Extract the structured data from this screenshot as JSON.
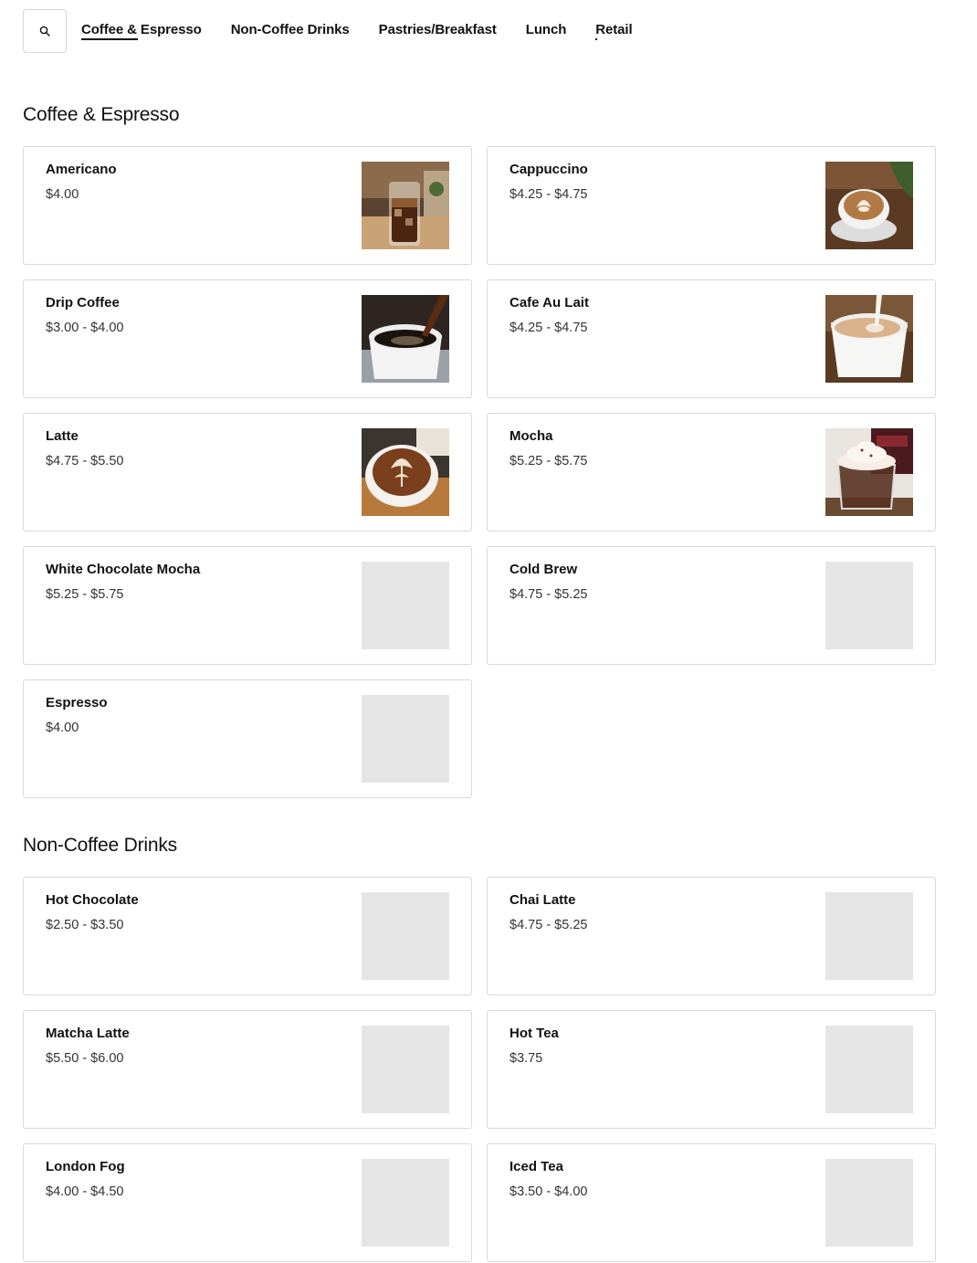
{
  "nav": {
    "search_icon": "search-icon",
    "tabs": [
      {
        "label": "Coffee & Espresso",
        "active": true
      },
      {
        "label": "Non-Coffee Drinks",
        "active": false
      },
      {
        "label": "Pastries/Breakfast",
        "active": false
      },
      {
        "label": "Lunch",
        "active": false
      },
      {
        "label": "Retail",
        "active": false
      }
    ]
  },
  "sections": [
    {
      "title": "Coffee & Espresso",
      "items": [
        {
          "name": "Americano",
          "price": "$4.00",
          "image": "iced-americano-photo"
        },
        {
          "name": "Cappuccino",
          "price": "$4.25 - $4.75",
          "image": "cappuccino-photo"
        },
        {
          "name": "Drip Coffee",
          "price": "$3.00 - $4.00",
          "image": "drip-coffee-photo"
        },
        {
          "name": "Cafe Au Lait",
          "price": "$4.25 - $4.75",
          "image": "cafe-au-lait-photo"
        },
        {
          "name": "Latte",
          "price": "$4.75 - $5.50",
          "image": "latte-photo"
        },
        {
          "name": "Mocha",
          "price": "$5.25 - $5.75",
          "image": "mocha-photo"
        },
        {
          "name": "White Chocolate Mocha",
          "price": "$5.25 - $5.75",
          "image": null
        },
        {
          "name": "Cold Brew",
          "price": "$4.75 - $5.25",
          "image": null
        },
        {
          "name": "Espresso",
          "price": "$4.00",
          "image": null
        }
      ]
    },
    {
      "title": "Non-Coffee Drinks",
      "items": [
        {
          "name": "Hot Chocolate",
          "price": "$2.50 - $3.50",
          "image": null
        },
        {
          "name": "Chai Latte",
          "price": "$4.75 - $5.25",
          "image": null
        },
        {
          "name": "Matcha Latte",
          "price": "$5.50 - $6.00",
          "image": null
        },
        {
          "name": "Hot Tea",
          "price": "$3.75",
          "image": null
        },
        {
          "name": "London Fog",
          "price": "$4.00 - $4.50",
          "image": null
        },
        {
          "name": "Iced Tea",
          "price": "$3.50 - $4.00",
          "image": null
        }
      ]
    }
  ],
  "colors": {
    "placeholder": "#e5e5e5",
    "border": "#d9d9d9",
    "text": "#111111"
  }
}
